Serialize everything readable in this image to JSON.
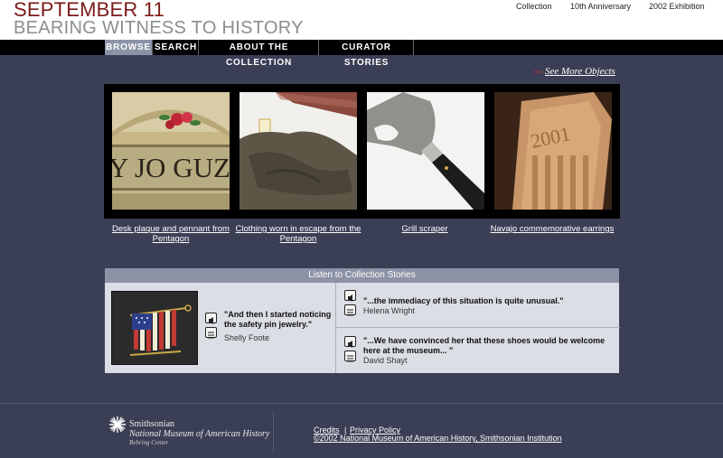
{
  "header": {
    "title": "SEPTEMBER 11",
    "subtitle": "BEARING WITNESS TO HISTORY",
    "links": [
      "Collection",
      "10th Anniversary",
      "2002 Exhibition"
    ]
  },
  "nav": {
    "items": [
      "BROWSE",
      "SEARCH",
      "ABOUT THE COLLECTION",
      "CURATOR STORIES"
    ],
    "active": "BROWSE"
  },
  "see_more": {
    "arrows": "»»",
    "label": "See More Objects"
  },
  "objects": [
    {
      "caption": "Desk plaque and pennant from Pentagon",
      "image_text": "Y JO GUZ"
    },
    {
      "caption": "Clothing worn in escape from the Pentagon"
    },
    {
      "caption": "Grill scraper"
    },
    {
      "caption": "Navajo commemorative earrings",
      "image_text": "2001"
    }
  ],
  "stories": {
    "heading": "Listen to Collection Stories",
    "items": [
      {
        "quote": "\"And then I started noticing the safety pin jewelry.\"",
        "person": "Shelly Foote"
      },
      {
        "quote": "\"...the immediacy of this situation is quite unusual.\"",
        "person": "Helena Wright"
      },
      {
        "quote": "\"...We have convinced her that these shoes would be welcome here at the museum... \"",
        "person": "David Shayt"
      }
    ]
  },
  "footer": {
    "org": "Smithsonian",
    "museum": "National Museum of American History",
    "center": "Behring Center",
    "links": [
      "Credits",
      "Privacy Policy"
    ],
    "separator": "|",
    "copyright": "©2002 National Museum of American History, Smithsonian Institution"
  }
}
